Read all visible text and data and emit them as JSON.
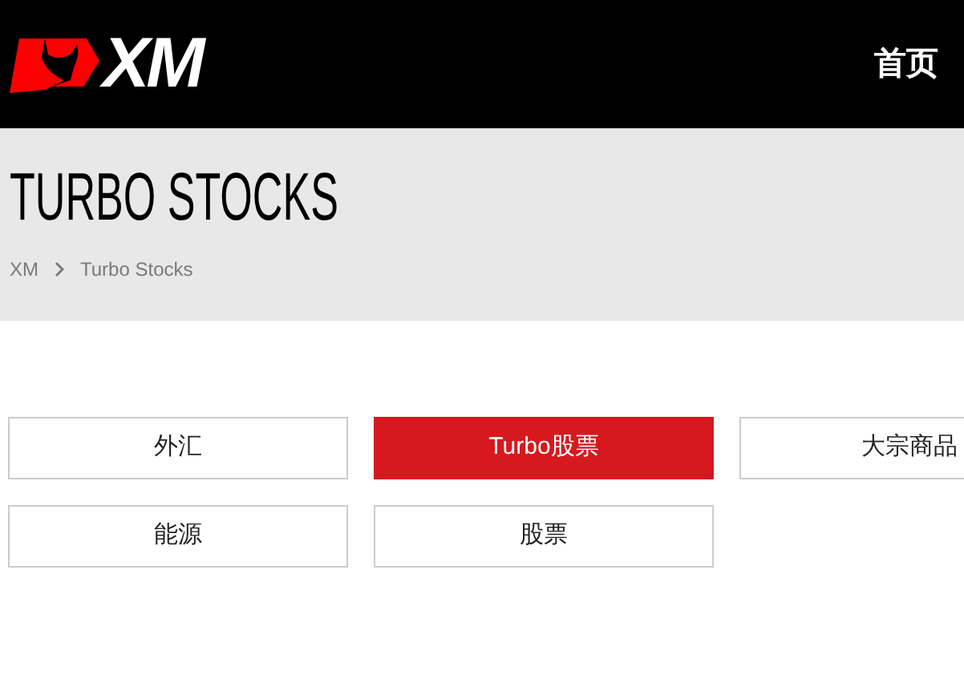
{
  "header": {
    "logo_text": "XM",
    "nav_link": "首页"
  },
  "hero": {
    "title": "TURBO STOCKS",
    "breadcrumb": [
      "XM",
      "Turbo Stocks"
    ]
  },
  "categories": [
    {
      "label": "外汇",
      "selected": false
    },
    {
      "label": "Turbo股票",
      "selected": true
    },
    {
      "label": "大宗商品",
      "selected": false
    },
    {
      "label": "能源",
      "selected": false
    },
    {
      "label": "股票",
      "selected": false
    }
  ]
}
